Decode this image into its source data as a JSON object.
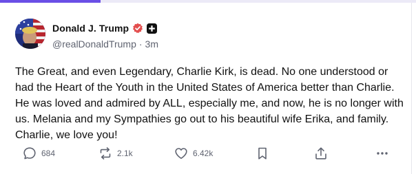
{
  "post": {
    "author": {
      "display_name": "Donald J. Trump",
      "handle": "@realDonaldTrump",
      "separator": "·",
      "time": "3m"
    },
    "text": "The Great, and even Legendary, Charlie Kirk, is dead. No one understood or had the Heart of the Youth in the United States of America better than Charlie. He was loved and admired by ALL, especially me, and now, he is no longer with us. Melania and my Sympathies go out to his beautiful wife Erika, and family. Charlie, we love you!",
    "actions": {
      "replies": "684",
      "reposts": "2.1k",
      "likes": "6.42k"
    }
  },
  "icons": {
    "verified": "verified-badge-icon",
    "plus": "plus-badge-icon",
    "reply": "reply-icon",
    "repost": "repost-icon",
    "like": "heart-icon",
    "bookmark": "bookmark-icon",
    "share": "share-icon",
    "more": "more-icon"
  },
  "colors": {
    "accent": "#6a4fe6",
    "verified": "#e34e4e",
    "text": "#111111",
    "muted": "#5f6370"
  }
}
